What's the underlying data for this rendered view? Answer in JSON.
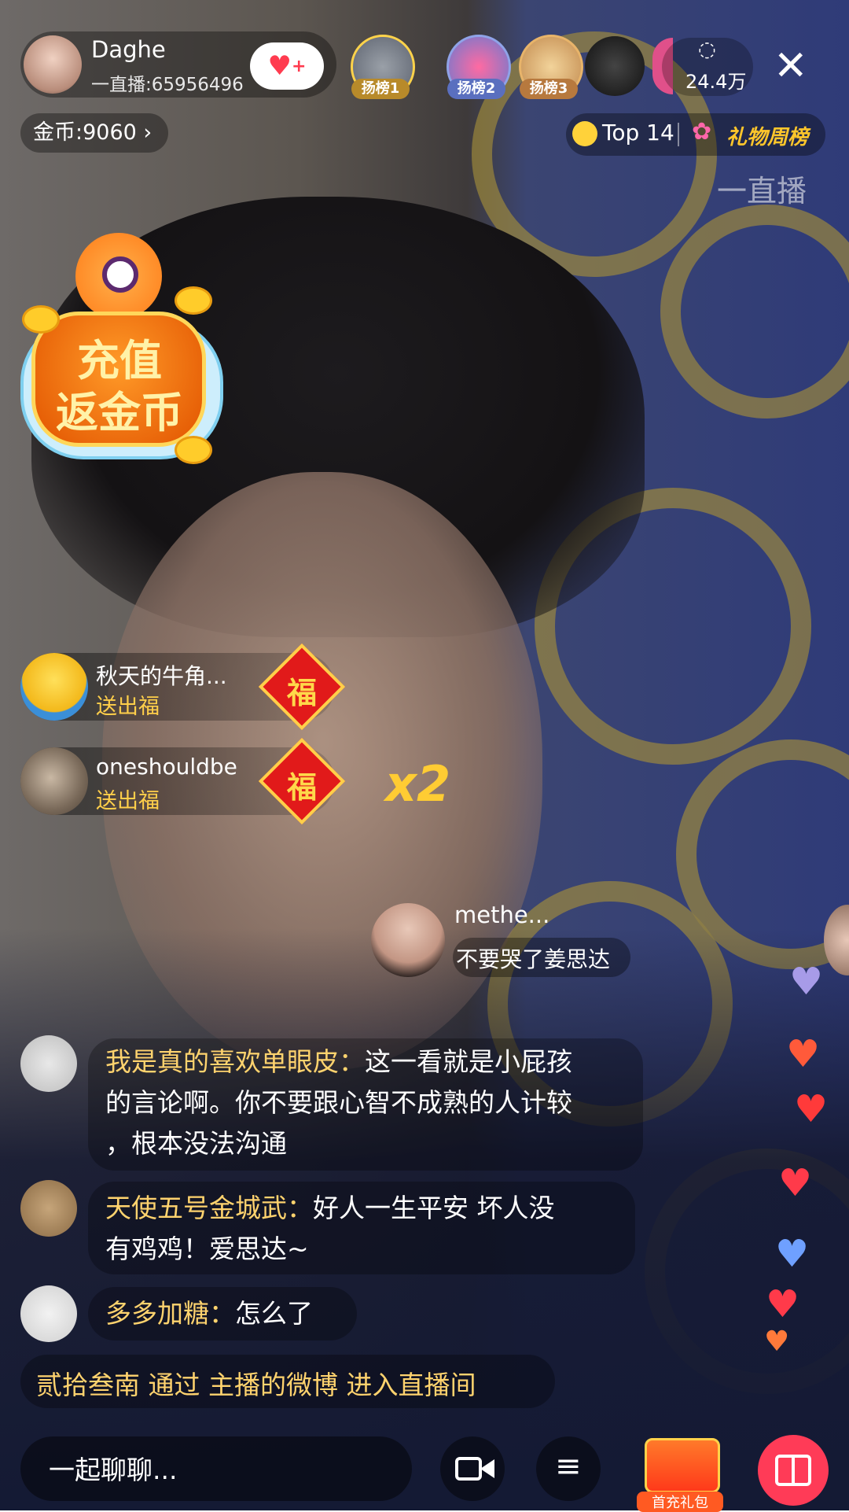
{
  "header": {
    "host_name": "Daghe",
    "host_id": "一直播:65956496",
    "follow_icon": "heart-plus-icon",
    "ranks": [
      {
        "label": "扬榜1",
        "color": "#8a8aa0"
      },
      {
        "label": "扬榜2",
        "color": "#5a6fbf"
      },
      {
        "label": "扬榜3",
        "color": "#b7793e"
      }
    ],
    "viewer_count": "24.4万",
    "close_icon": "close-icon"
  },
  "subheader": {
    "coins": "金币:9060 ›",
    "top_rank": "Top 14",
    "gift_week": "礼物周榜",
    "watermark": "一直播"
  },
  "promo": {
    "line1": "充值",
    "line2": "返金币"
  },
  "gifts": [
    {
      "name": "秋天的牛角...",
      "action": "送出福",
      "gift": "福"
    },
    {
      "name": "oneshouldbe",
      "action": "送出福",
      "gift": "福"
    }
  ],
  "combo": "x2",
  "floating_comment": {
    "name": "methe...",
    "message": "不要哭了姜思达"
  },
  "chat": [
    {
      "user": "我是真的喜欢单眼皮：",
      "line1": "这一看就是小屁孩",
      "line2": "的言论啊。你不要跟心智不成熟的人计较",
      "line3": "，根本没法沟通"
    },
    {
      "user": "天使五号金城武：",
      "line1": "好人一生平安  坏人没",
      "line2": "有鸡鸡！爱思达~"
    },
    {
      "user": "多多加糖：",
      "line1": "怎么了"
    }
  ],
  "enter_notice": "贰拾叁南 通过  主播的微博 进入直播间",
  "bottom": {
    "input_placeholder": "一起聊聊...",
    "camera_icon": "video-camera-icon",
    "menu_icon": "menu-icon",
    "first_charge": "首充礼包",
    "gift_icon": "gift-icon"
  },
  "colors": {
    "accent": "#ff3b57",
    "chat_user": "#ffd36e",
    "gold": "#ffcc33"
  }
}
